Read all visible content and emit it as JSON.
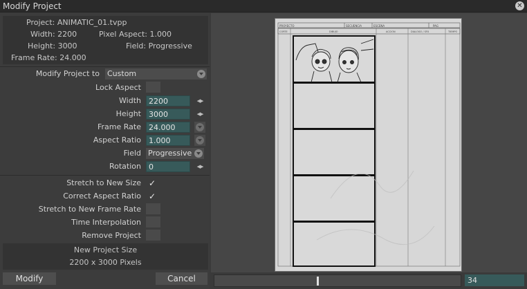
{
  "window": {
    "title": "Modify Project"
  },
  "info": {
    "project": "Project: ANIMATIC_01.tvpp",
    "width": "Width: 2200",
    "pixel_aspect": "Pixel Aspect: 1.000",
    "height": "Height: 3000",
    "field": "Field: Progressive",
    "frame_rate": "Frame Rate: 24.000"
  },
  "form": {
    "modify_to_label": "Modify Project to",
    "modify_to_value": "Custom",
    "lock_aspect_label": "Lock Aspect",
    "width_label": "Width",
    "width_value": "2200",
    "height_label": "Height",
    "height_value": "3000",
    "frame_rate_label": "Frame Rate",
    "frame_rate_value": "24.000",
    "aspect_ratio_label": "Aspect Ratio",
    "aspect_ratio_value": "1.000",
    "field_label": "Field",
    "field_value": "Progressive",
    "rotation_label": "Rotation",
    "rotation_value": "0"
  },
  "options": [
    {
      "label": "Stretch to New Size",
      "checked": true
    },
    {
      "label": "Correct Aspect Ratio",
      "checked": true
    },
    {
      "label": "Stretch to New Frame Rate",
      "checked": false
    },
    {
      "label": "Time Interpolation",
      "checked": false
    },
    {
      "label": "Remove Project",
      "checked": false
    }
  ],
  "new_size": {
    "title": "New Project Size",
    "value": "2200 x 3000 Pixels"
  },
  "buttons": {
    "modify": "Modify",
    "cancel": "Cancel"
  },
  "preview": {
    "frame_number": "34",
    "slider_position": 0.42,
    "header": {
      "proyecto": "PROYECTO",
      "secuencia": "SECUENCIA",
      "escena": "ESCENA",
      "pag": "PAG",
      "corte": "CORTE",
      "dibujo": "DIBUJO",
      "accion": "ACCION",
      "dialogo": "DIALOGO / SFX",
      "tiempo": "TIEMPO"
    }
  },
  "colors": {
    "field_bg": "#375a5a",
    "panel_bg": "#3c3c3c",
    "page_bg": "#d7d7d7"
  }
}
